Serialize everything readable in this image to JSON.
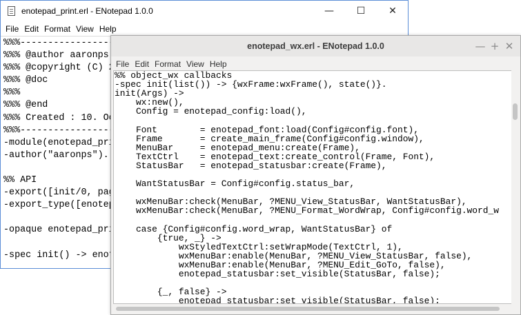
{
  "back_window": {
    "title": "enotepad_print.erl - ENotepad 1.0.0",
    "controls": {
      "minimize": "—",
      "maximize": "☐",
      "close": "✕"
    },
    "menu": [
      "File",
      "Edit",
      "Format",
      "View",
      "Help"
    ],
    "code_lines": [
      "%%%-------------------------",
      "%%% @author aaronps ",
      "%%% @copyright (C) 2",
      "%%% @doc",
      "%%%",
      "%%% @end",
      "%%% Created : 10. Oc",
      "%%%-------------------------",
      "-module(enotepad_pri",
      "-author(\"aaronps\").",
      "",
      "%% API",
      "-export([init/0, pag",
      "-export_type([enotep",
      "",
      "-opaque enotepad_pri",
      "",
      "-spec init() -> enot"
    ]
  },
  "front_window": {
    "title": "enotepad_wx.erl - ENotepad 1.0.0",
    "controls": {
      "minimize": "—",
      "maximize": "+",
      "close": "✕"
    },
    "menu": [
      "File",
      "Edit",
      "Format",
      "View",
      "Help"
    ],
    "code_lines": [
      "%% object_wx callbacks",
      "-spec init(list()) -> {wxFrame:wxFrame(), state()}.",
      "init(Args) ->",
      "    wx:new(),",
      "    Config = enotepad_config:load(),",
      "",
      "    Font        = enotepad_font:load(Config#config.font),",
      "    Frame       = create_main_frame(Config#config.window),",
      "    MenuBar     = enotepad_menu:create(Frame),",
      "    TextCtrl    = enotepad_text:create_control(Frame, Font),",
      "    StatusBar   = enotepad_statusbar:create(Frame),",
      "",
      "    WantStatusBar = Config#config.status_bar,",
      "",
      "    wxMenuBar:check(MenuBar, ?MENU_View_StatusBar, WantStatusBar),",
      "    wxMenuBar:check(MenuBar, ?MENU_Format_WordWrap, Config#config.word_w",
      "",
      "    case {Config#config.word_wrap, WantStatusBar} of",
      "        {true, _} ->",
      "            wxStyledTextCtrl:setWrapMode(TextCtrl, 1),",
      "            wxMenuBar:enable(MenuBar, ?MENU_View_StatusBar, false),",
      "            wxMenuBar:enable(MenuBar, ?MENU_Edit_GoTo, false),",
      "            enotepad_statusbar:set_visible(StatusBar, false);",
      "",
      "        {_, false} ->",
      "            enotepad_statusbar:set_visible(StatusBar, false);"
    ]
  }
}
